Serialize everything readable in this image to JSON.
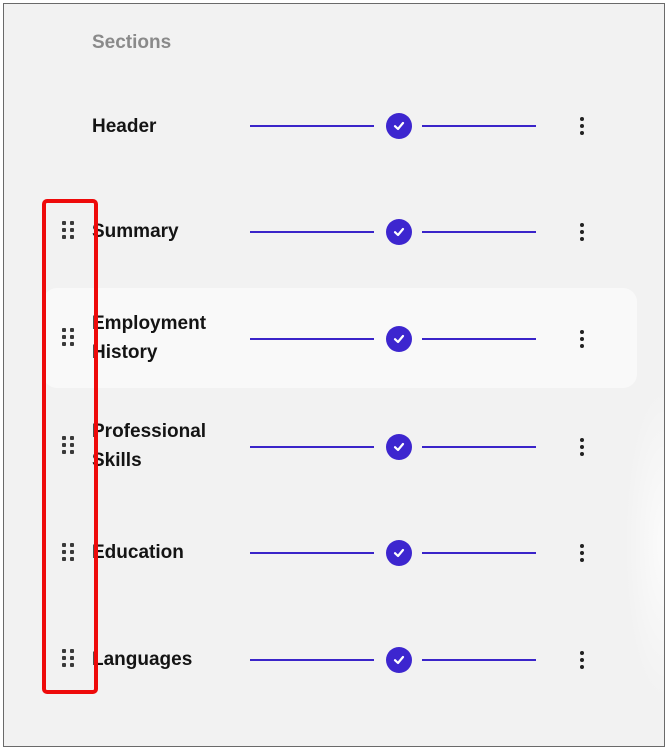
{
  "panel": {
    "title": "Sections"
  },
  "sections": [
    {
      "label": "Header",
      "has_drag_handle": false,
      "completed": true
    },
    {
      "label": "Summary",
      "has_drag_handle": true,
      "completed": true
    },
    {
      "label": "Employment\nHistory",
      "has_drag_handle": true,
      "completed": true,
      "highlighted": true
    },
    {
      "label": "Professional\nSkills",
      "has_drag_handle": true,
      "completed": true
    },
    {
      "label": "Education",
      "has_drag_handle": true,
      "completed": true
    },
    {
      "label": "Languages",
      "has_drag_handle": true,
      "completed": true
    }
  ],
  "icons": {
    "drag": "drag-handle-icon",
    "check": "check-circle-icon",
    "more": "more-vertical-icon"
  },
  "colors": {
    "accent": "#3d26cf",
    "progress_line": "#3a24c9",
    "annotation_box": "#ee0a0a",
    "muted_title": "#8a8a8a"
  }
}
